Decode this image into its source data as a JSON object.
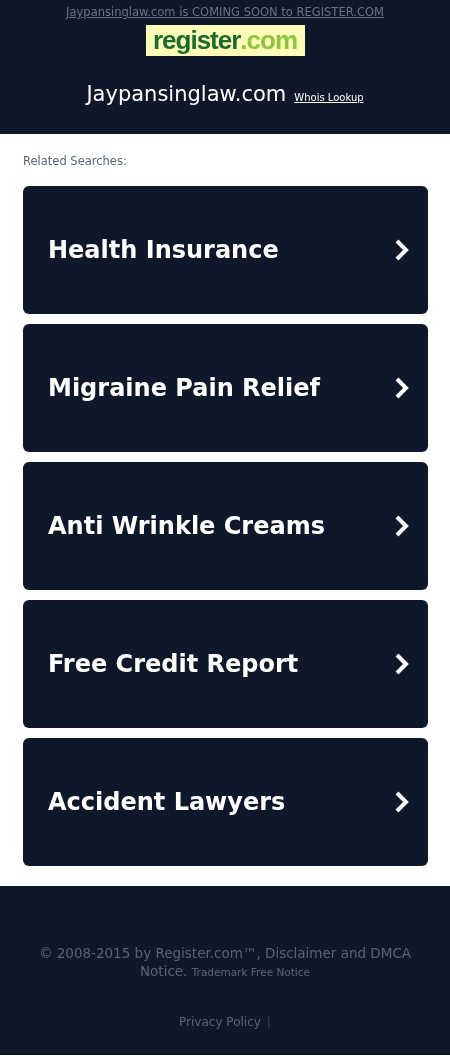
{
  "banner": {
    "link": "Jaypansinglaw.com is COMING SOON to REGISTER.COM",
    "logo": {
      "name": "register",
      "suffix": ".com"
    }
  },
  "header": {
    "domain": "Jaypansinglaw.com",
    "whois": "Whois Lookup"
  },
  "related": {
    "label": "Related Searches:",
    "items": [
      {
        "label": "Health Insurance"
      },
      {
        "label": "Migraine Pain Relief"
      },
      {
        "label": "Anti Wrinkle Creams"
      },
      {
        "label": "Free Credit Report"
      },
      {
        "label": "Accident Lawyers"
      }
    ]
  },
  "footer": {
    "copyright": "© 2008-2015 by Register.com™, Disclaimer and DMCA Notice.",
    "trademark": "Trademark Free Notice",
    "privacy": "Privacy Policy",
    "separator": "|"
  }
}
